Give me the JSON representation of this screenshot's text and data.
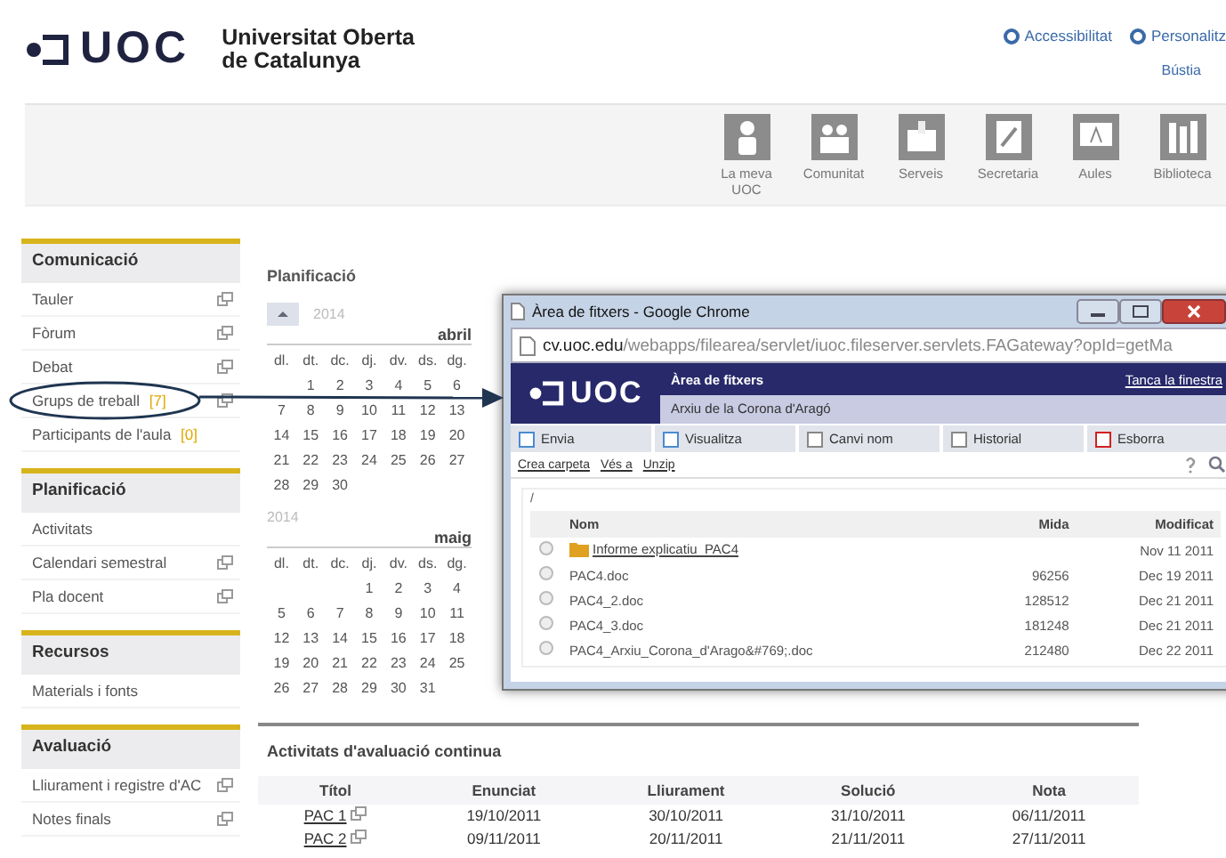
{
  "header": {
    "logo": "UOC",
    "university_lines": [
      "Universitat Oberta",
      "de Catalunya"
    ],
    "top_links": [
      {
        "label": "Accessibilitat"
      },
      {
        "label": "Personalitz"
      }
    ],
    "sub_links": [
      "Bústia"
    ]
  },
  "nav": [
    {
      "label": "La meva UOC"
    },
    {
      "label": "Comunitat"
    },
    {
      "label": "Serveis"
    },
    {
      "label": "Secretaria"
    },
    {
      "label": "Aules"
    },
    {
      "label": "Biblioteca"
    }
  ],
  "sidebar": [
    {
      "title": "Comunicació",
      "items": [
        {
          "label": "Tauler",
          "popup": true
        },
        {
          "label": "Fòrum",
          "popup": true
        },
        {
          "label": "Debat",
          "popup": true
        },
        {
          "label": "Grups de treball",
          "count": "[7]",
          "popup": true,
          "circled": true
        },
        {
          "label": "Participants de l'aula",
          "count": "[0]",
          "popup": false
        }
      ]
    },
    {
      "title": "Planificació",
      "items": [
        {
          "label": "Activitats",
          "popup": false
        },
        {
          "label": "Calendari semestral",
          "popup": true
        },
        {
          "label": "Pla docent",
          "popup": true
        }
      ]
    },
    {
      "title": "Recursos",
      "items": [
        {
          "label": "Materials i fonts",
          "popup": false
        }
      ]
    },
    {
      "title": "Avaluació",
      "items": [
        {
          "label": "Lliurament i registre d'AC",
          "popup": true
        },
        {
          "label": "Notes finals",
          "popup": true
        }
      ]
    }
  ],
  "planning": {
    "title": "Planificació",
    "calendars": [
      {
        "year": "2014",
        "month": "abril",
        "weekdays": [
          "dl.",
          "dt.",
          "dc.",
          "dj.",
          "dv.",
          "ds.",
          "dg."
        ],
        "weeks": [
          [
            "1",
            "2",
            "3",
            "4",
            "5",
            "6"
          ],
          [
            "7",
            "8",
            "9",
            "10",
            "11",
            "12",
            "13"
          ],
          [
            "14",
            "15",
            "16",
            "17",
            "18",
            "19",
            "20"
          ],
          [
            "21",
            "22",
            "23",
            "24",
            "25",
            "26",
            "27"
          ],
          [
            "28",
            "29",
            "30"
          ]
        ]
      },
      {
        "year": "2014",
        "month": "maig",
        "weekdays": [
          "dl.",
          "dt.",
          "dc.",
          "dj.",
          "dv.",
          "ds.",
          "dg."
        ],
        "weeks": [
          [
            "1",
            "2",
            "3",
            "4"
          ],
          [
            "5",
            "6",
            "7",
            "8",
            "9",
            "10",
            "11"
          ],
          [
            "12",
            "13",
            "14",
            "15",
            "16",
            "17",
            "18"
          ],
          [
            "19",
            "20",
            "21",
            "22",
            "23",
            "24",
            "25"
          ],
          [
            "26",
            "27",
            "28",
            "29",
            "30",
            "31"
          ]
        ]
      }
    ]
  },
  "activities": {
    "title": "Activitats d'avaluació continua",
    "columns": [
      "Títol",
      "Enunciat",
      "Lliurament",
      "Solució",
      "Nota"
    ],
    "rows": [
      {
        "cells": [
          "PAC 1",
          "19/10/2011",
          "30/10/2011",
          "31/10/2011",
          "06/11/2011"
        ]
      },
      {
        "cells": [
          "PAC 2",
          "09/11/2011",
          "20/11/2011",
          "21/11/2011",
          "27/11/2011"
        ]
      }
    ]
  },
  "popup_window": {
    "title": "Àrea de fitxers - Google Chrome",
    "url_host": "cv.uoc.edu",
    "url_path": "/webapps/filearea/servlet/iuoc.fileserver.servlets.FAGateway?opId=getMa",
    "logo": "UOC",
    "app_title": "Àrea de fitxers",
    "subtitle": "Arxiu de la Corona d'Aragó",
    "close_link": "Tanca la finestra",
    "toolbar": [
      {
        "label": "Envia"
      },
      {
        "label": "Visualitza"
      },
      {
        "label": "Canvi nom"
      },
      {
        "label": "Historial"
      },
      {
        "label": "Esborra"
      }
    ],
    "links": [
      "Crea carpeta",
      "Vés a",
      "Unzip"
    ],
    "path": "/",
    "columns": [
      "Nom",
      "Mida",
      "Modificat"
    ],
    "files": [
      {
        "kind": "folder",
        "name": "Informe explicatiu_PAC4",
        "modified": "Nov 11 2011",
        "selected": false
      },
      {
        "kind": "file",
        "name": "PAC4.doc",
        "size": "96256",
        "modified": "Dec 19 2011",
        "selected": false
      },
      {
        "kind": "file",
        "name": "PAC4_2.doc",
        "size": "128512",
        "modified": "Dec 21 2011",
        "selected": false
      },
      {
        "kind": "file",
        "name": "PAC4_3.doc",
        "size": "181248",
        "modified": "Dec 21 2011",
        "selected": false
      },
      {
        "kind": "file",
        "name": "PAC4_Arxiu_Corona_d'Arago&#769;.doc",
        "size": "212480",
        "modified": "Dec 22 2011",
        "selected": false
      }
    ]
  }
}
